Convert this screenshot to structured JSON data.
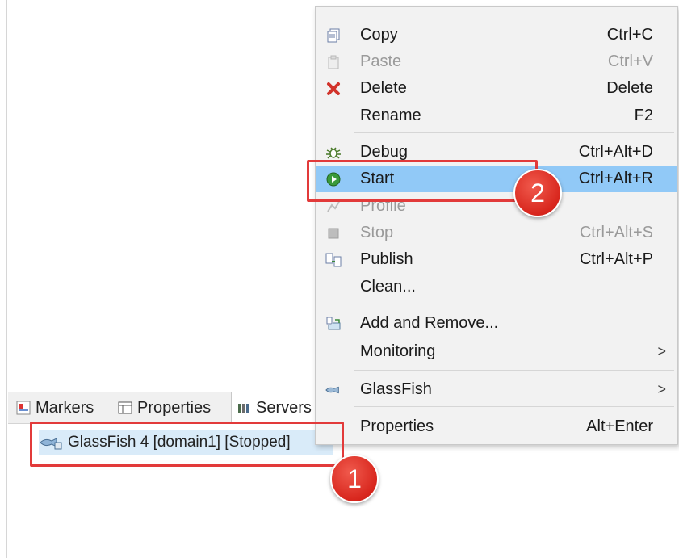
{
  "menu": {
    "items": [
      {
        "label": "Copy",
        "accel": "Ctrl+C",
        "icon": "copy-icon",
        "enabled": true
      },
      {
        "label": "Paste",
        "accel": "Ctrl+V",
        "icon": "paste-icon",
        "enabled": false
      },
      {
        "label": "Delete",
        "accel": "Delete",
        "icon": "delete-icon",
        "enabled": true
      },
      {
        "label": "Rename",
        "accel": "F2",
        "icon": "",
        "enabled": true
      },
      {
        "label": "Debug",
        "accel": "Ctrl+Alt+D",
        "icon": "debug-icon",
        "enabled": true
      },
      {
        "label": "Start",
        "accel": "Ctrl+Alt+R",
        "icon": "start-icon",
        "enabled": true,
        "highlighted": true
      },
      {
        "label": "Profile",
        "accel": "",
        "icon": "profile-icon",
        "enabled": false
      },
      {
        "label": "Stop",
        "accel": "Ctrl+Alt+S",
        "icon": "stop-icon",
        "enabled": false
      },
      {
        "label": "Publish",
        "accel": "Ctrl+Alt+P",
        "icon": "publish-icon",
        "enabled": true
      },
      {
        "label": "Clean...",
        "accel": "",
        "icon": "",
        "enabled": true
      },
      {
        "label": "Add and Remove...",
        "accel": "",
        "icon": "add-remove-icon",
        "enabled": true
      },
      {
        "label": "Monitoring",
        "accel": "",
        "icon": "",
        "enabled": true,
        "submenu": ">"
      },
      {
        "label": "GlassFish",
        "accel": "",
        "icon": "glassfish-icon",
        "enabled": true,
        "submenu": ">"
      },
      {
        "label": "Properties",
        "accel": "Alt+Enter",
        "icon": "",
        "enabled": true
      }
    ]
  },
  "tabs": [
    {
      "label": "Markers",
      "icon": "markers-icon"
    },
    {
      "label": "Properties",
      "icon": "properties-icon"
    },
    {
      "label": "Servers",
      "icon": "servers-icon"
    }
  ],
  "server": {
    "label": "GlassFish 4 [domain1]  [Stopped]"
  },
  "badges": {
    "one": "1",
    "two": "2"
  },
  "colors": {
    "highlight": "#91c9f7",
    "selection": "#d9ebf9",
    "annotation": "#e23a3a"
  }
}
